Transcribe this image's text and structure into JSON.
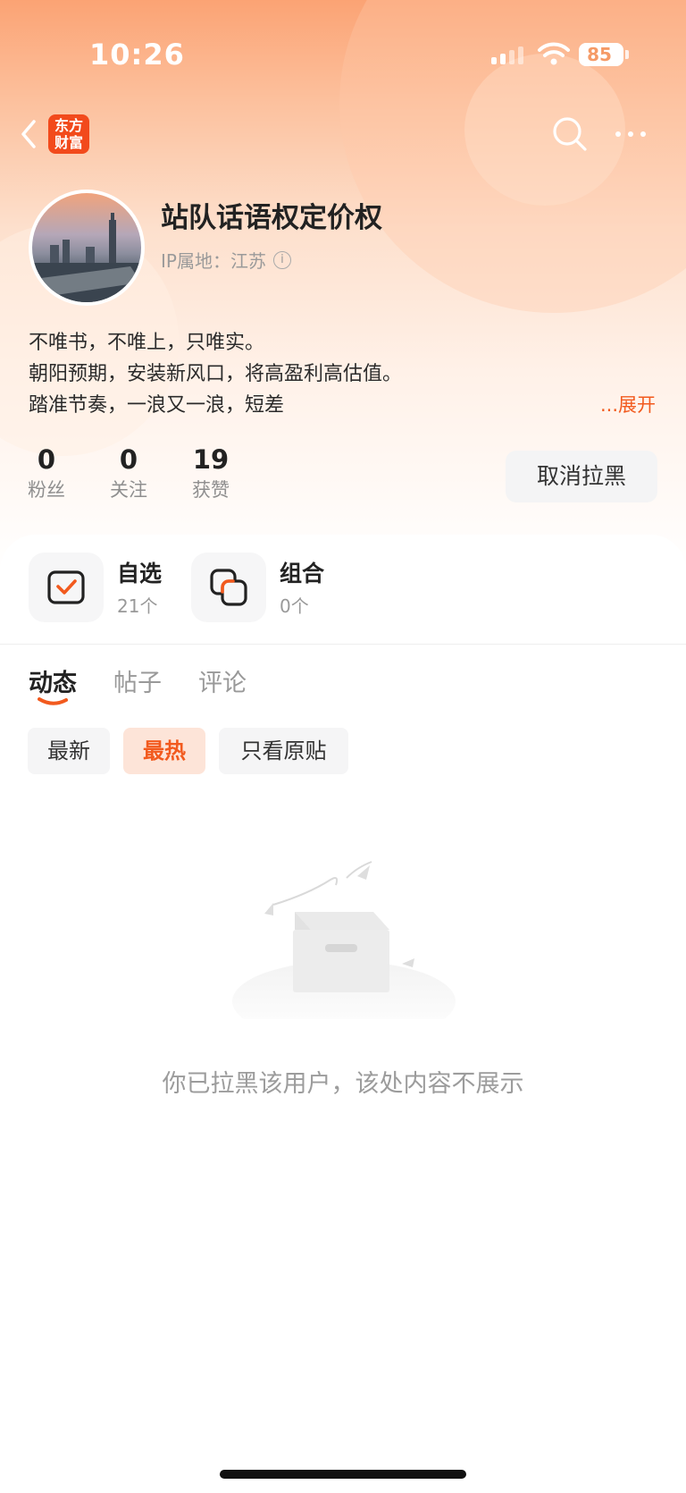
{
  "status_bar": {
    "time": "10:26",
    "battery": "85"
  },
  "header": {
    "logo_line1": "东方",
    "logo_line2": "财富"
  },
  "profile": {
    "username": "站队话语权定价权",
    "ip_label": "IP属地：江苏",
    "bio_lines": [
      "不唯书，不唯上，只唯实。",
      "朝阳预期，安装新风口，将高盈利高估值。",
      "踏准节奏，一浪又一浪，短差"
    ],
    "expand": "...展开"
  },
  "stats": [
    {
      "value": "0",
      "label": "粉丝"
    },
    {
      "value": "0",
      "label": "关注"
    },
    {
      "value": "19",
      "label": "获赞"
    }
  ],
  "unblock_button": "取消拉黑",
  "shortcuts": [
    {
      "title": "自选",
      "sub": "21个",
      "icon": "watchlist-check-icon"
    },
    {
      "title": "组合",
      "sub": "0个",
      "icon": "portfolio-icon"
    }
  ],
  "tabs": [
    {
      "label": "动态",
      "active": true
    },
    {
      "label": "帖子",
      "active": false
    },
    {
      "label": "评论",
      "active": false
    }
  ],
  "filters": [
    {
      "label": "最新",
      "active": false
    },
    {
      "label": "最热",
      "active": true
    },
    {
      "label": "只看原贴",
      "active": false
    }
  ],
  "empty_state": {
    "message": "你已拉黑该用户，该处内容不展示",
    "icon": "empty-box-icon"
  },
  "colors": {
    "accent": "#f25a1e",
    "hero_top": "#fba374"
  }
}
